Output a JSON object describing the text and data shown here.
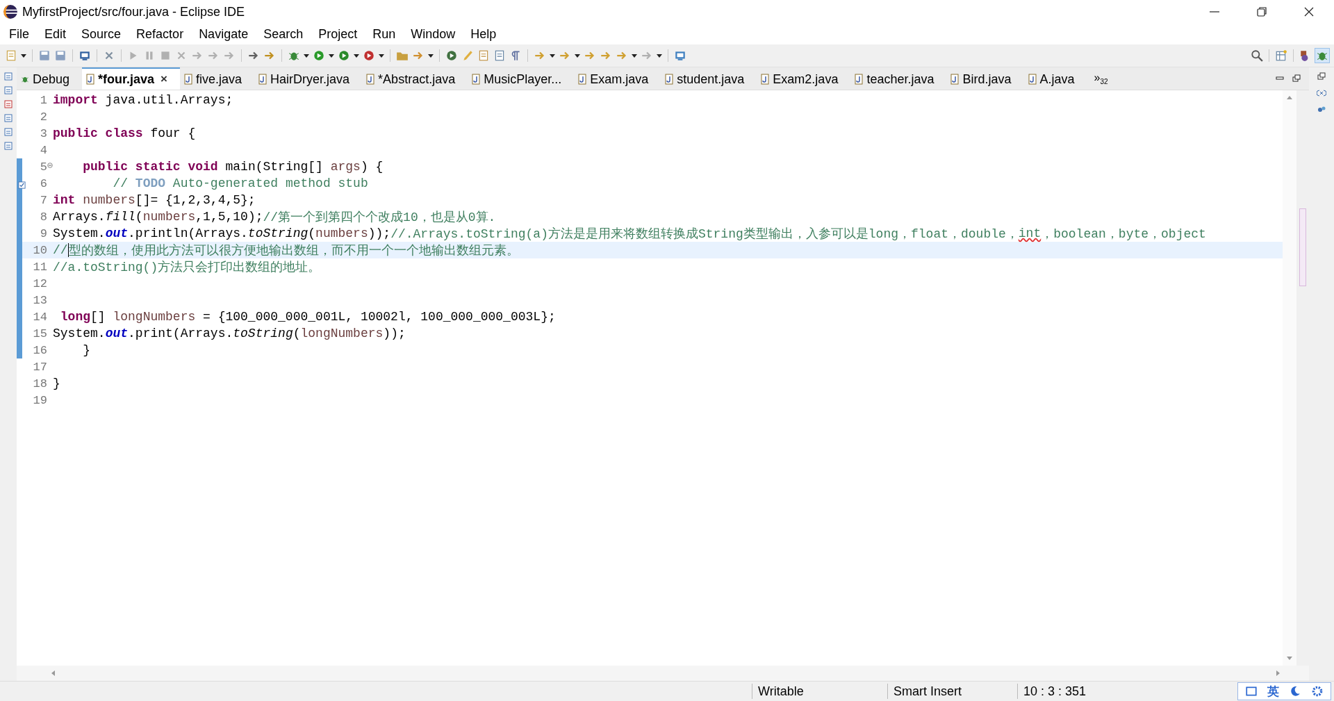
{
  "window": {
    "title": "MyfirstProject/src/four.java - Eclipse IDE"
  },
  "menu": [
    "File",
    "Edit",
    "Source",
    "Refactor",
    "Navigate",
    "Search",
    "Project",
    "Run",
    "Window",
    "Help"
  ],
  "tabs": [
    {
      "kind": "view",
      "label": "Debug",
      "selected": false
    },
    {
      "kind": "file",
      "label": "*four.java",
      "selected": true,
      "close": "×"
    },
    {
      "kind": "file",
      "label": "five.java",
      "selected": false
    },
    {
      "kind": "file",
      "label": "HairDryer.java",
      "selected": false
    },
    {
      "kind": "file",
      "label": "*Abstract.java",
      "selected": false
    },
    {
      "kind": "file",
      "label": "MusicPlayer...",
      "selected": false
    },
    {
      "kind": "file",
      "label": "Exam.java",
      "selected": false
    },
    {
      "kind": "file",
      "label": "student.java",
      "selected": false
    },
    {
      "kind": "file",
      "label": "Exam2.java",
      "selected": false
    },
    {
      "kind": "file",
      "label": "teacher.java",
      "selected": false
    },
    {
      "kind": "file",
      "label": "Bird.java",
      "selected": false
    },
    {
      "kind": "file",
      "label": "A.java",
      "selected": false
    }
  ],
  "tab_overflow": {
    "glyph": "»",
    "count": "32"
  },
  "editor": {
    "lines": [
      {
        "number": "1",
        "changed": false,
        "current": false,
        "tokens": [
          {
            "kind": "kw",
            "text": "import"
          },
          {
            "kind": "plain",
            "text": " java.util.Arrays;"
          }
        ]
      },
      {
        "number": "2",
        "changed": false,
        "current": false
      },
      {
        "number": "3",
        "changed": false,
        "current": false,
        "tokens": [
          {
            "kind": "kw",
            "text": "public"
          },
          {
            "kind": "kw",
            "text": " class"
          },
          {
            "kind": "plain",
            "text": " four {"
          }
        ]
      },
      {
        "number": "4",
        "changed": false,
        "current": false
      },
      {
        "number": "5",
        "changed": true,
        "current": false,
        "foldable": true,
        "tokens": [
          {
            "kind": "kw",
            "text": "    public"
          },
          {
            "kind": "kw",
            "text": " static"
          },
          {
            "kind": "kw",
            "text": " void"
          },
          {
            "kind": "plain",
            "text": " main(String[] "
          },
          {
            "kind": "var",
            "text": "args"
          },
          {
            "kind": "plain",
            "text": ") {"
          }
        ]
      },
      {
        "number": "6",
        "changed": true,
        "current": false,
        "task": true,
        "tokens": [
          {
            "kind": "comment",
            "text": "        // "
          },
          {
            "kind": "todo",
            "text": "TODO"
          },
          {
            "kind": "comment",
            "text": " Auto-generated method stub"
          }
        ]
      },
      {
        "number": "7",
        "changed": true,
        "current": false,
        "tokens": [
          {
            "kind": "kw",
            "text": "int"
          },
          {
            "kind": "var",
            "text": " numbers"
          },
          {
            "kind": "plain",
            "text": "[]= {1,2,3,4,5};"
          }
        ]
      },
      {
        "number": "8",
        "changed": true,
        "current": false,
        "tokens": [
          {
            "kind": "plain",
            "text": "Arrays."
          },
          {
            "kind": "static",
            "text": "fill"
          },
          {
            "kind": "plain",
            "text": "("
          },
          {
            "kind": "var",
            "text": "numbers"
          },
          {
            "kind": "plain",
            "text": ",1,5,10);"
          },
          {
            "kind": "comment",
            "text": "//第一个到第四个个改成10，也是从0算."
          }
        ]
      },
      {
        "number": "9",
        "changed": true,
        "current": false,
        "tokens": [
          {
            "kind": "plain",
            "text": "System."
          },
          {
            "kind": "field",
            "text": "out"
          },
          {
            "kind": "plain",
            "text": ".println(Arrays."
          },
          {
            "kind": "static",
            "text": "toString"
          },
          {
            "kind": "plain",
            "text": "("
          },
          {
            "kind": "var",
            "text": "numbers"
          },
          {
            "kind": "plain",
            "text": "));"
          },
          {
            "kind": "comment",
            "text": "//.Arrays.toString(a)方法是是用来将数组转换成String类型输出，入参可以是long，float，double，"
          },
          {
            "kind": "misspelled",
            "text": "int"
          },
          {
            "kind": "comment",
            "text": "，boolean，byte，object"
          }
        ]
      },
      {
        "number": "10",
        "changed": true,
        "current": true,
        "tokens": [
          {
            "kind": "comment",
            "text": "//"
          },
          {
            "kind": "comment",
            "text": "型的数组，使用此方法可以很方便地输出数组，而不用一个一个地输出数组元素。",
            "caret_before": true
          }
        ]
      },
      {
        "number": "11",
        "changed": true,
        "current": false,
        "tokens": [
          {
            "kind": "comment",
            "text": "//a.toString()方法只会打印出数组的地址。"
          }
        ]
      },
      {
        "number": "12",
        "changed": true,
        "current": false
      },
      {
        "number": "13",
        "changed": true,
        "current": false
      },
      {
        "number": "14",
        "changed": true,
        "current": false,
        "tokens": [
          {
            "kind": "kw",
            "text": " long"
          },
          {
            "kind": "plain",
            "text": "[] "
          },
          {
            "kind": "var",
            "text": "longNumbers"
          },
          {
            "kind": "plain",
            "text": " = {100_000_000_001L, 10002l, 100_000_000_003L};"
          }
        ]
      },
      {
        "number": "15",
        "changed": true,
        "current": false,
        "tokens": [
          {
            "kind": "plain",
            "text": "System."
          },
          {
            "kind": "field",
            "text": "out"
          },
          {
            "kind": "plain",
            "text": ".print(Arrays."
          },
          {
            "kind": "static",
            "text": "toString"
          },
          {
            "kind": "plain",
            "text": "("
          },
          {
            "kind": "var",
            "text": "longNumbers"
          },
          {
            "kind": "plain",
            "text": "));"
          }
        ]
      },
      {
        "number": "16",
        "changed": true,
        "current": false,
        "tokens": [
          {
            "kind": "plain",
            "text": "    }"
          }
        ]
      },
      {
        "number": "17",
        "changed": false,
        "current": false
      },
      {
        "number": "18",
        "changed": false,
        "current": false,
        "tokens": [
          {
            "kind": "plain",
            "text": "}"
          }
        ]
      },
      {
        "number": "19",
        "changed": false,
        "current": false
      }
    ]
  },
  "status_bar": [
    "Writable",
    "Smart Insert",
    "10 : 3 : 351"
  ],
  "ime_bar": {
    "mode": "英"
  }
}
